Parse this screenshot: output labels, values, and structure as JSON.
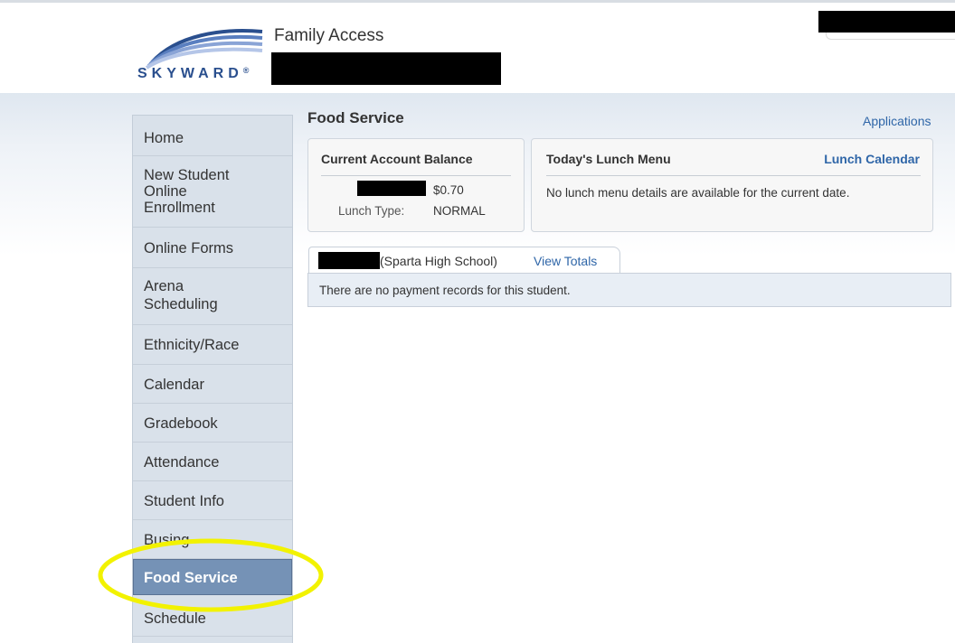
{
  "header": {
    "logo_text": "SKYWARD",
    "logo_mark": "®",
    "title": "Family Access"
  },
  "sidebar": {
    "items": [
      {
        "label": "Home"
      },
      {
        "label": "New Student Online Enrollment"
      },
      {
        "label": "Online Forms"
      },
      {
        "label": "Arena Scheduling"
      },
      {
        "label": "Ethnicity/Race"
      },
      {
        "label": "Calendar"
      },
      {
        "label": "Gradebook"
      },
      {
        "label": "Attendance"
      },
      {
        "label": "Student Info"
      },
      {
        "label": "Busing"
      },
      {
        "label": "Food Service",
        "active": true
      },
      {
        "label": "Schedule"
      }
    ]
  },
  "main": {
    "title": "Food Service",
    "applications_link": "Applications",
    "balance_card": {
      "title": "Current Account Balance",
      "balance": "$0.70",
      "lunch_type_label": "Lunch Type:",
      "lunch_type_value": "NORMAL"
    },
    "menu_card": {
      "title": "Today's Lunch Menu",
      "calendar_link": "Lunch Calendar",
      "message": "No lunch menu details are available for the current date."
    },
    "student_tab": {
      "school": "(Sparta High School)",
      "view_totals": "View Totals"
    },
    "payment_message": "There are no payment records for this student."
  },
  "colors": {
    "link": "#2f66a8",
    "active_nav": "#7592b6",
    "sidebar_bg": "#d9e1ea",
    "highlight_circle": "#f2f200"
  }
}
